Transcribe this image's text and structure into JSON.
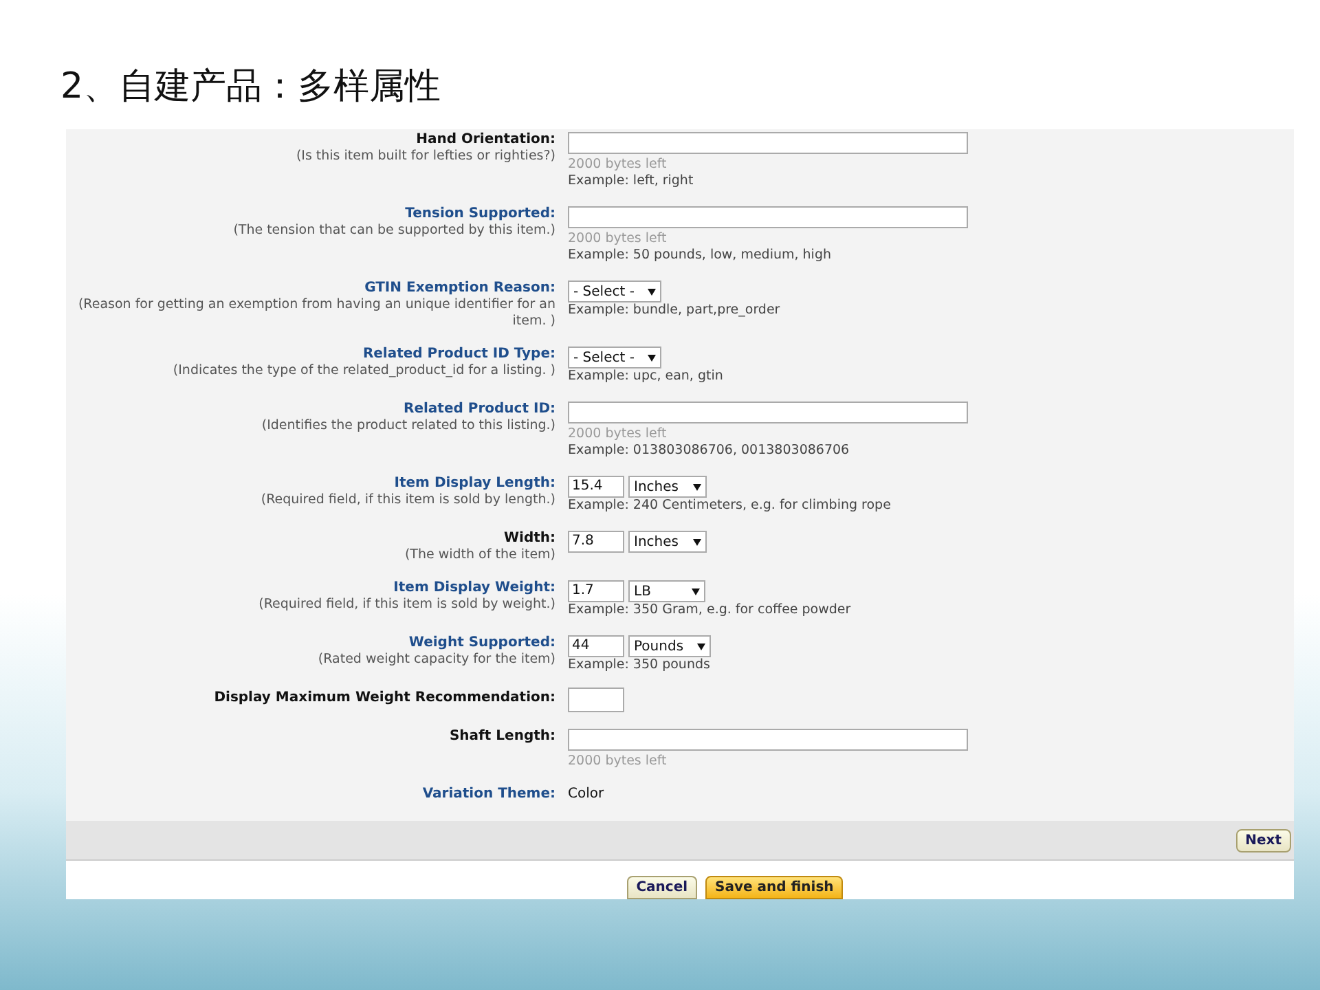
{
  "slide_title": "2、自建产品：多样属性",
  "rows": [
    {
      "label": "Hand Orientation:",
      "linked": false,
      "hint": "(Is this item built for lefties or righties?)",
      "kind": "text",
      "bytes_left": "2000 bytes left",
      "example": "Example: left, right"
    },
    {
      "label": "Tension Supported:",
      "linked": true,
      "hint": "(The tension that can be supported by this item.)",
      "kind": "text",
      "bytes_left": "2000 bytes left",
      "example": "Example: 50 pounds, low, medium, high"
    },
    {
      "label": "GTIN Exemption Reason:",
      "linked": true,
      "hint": "(Reason for getting an exemption from having an unique identifier for an item. )",
      "kind": "select",
      "select": "- Select -",
      "example": "Example: bundle, part,pre_order"
    },
    {
      "label": "Related Product ID Type:",
      "linked": true,
      "hint": "(Indicates the type of the related_product_id for a listing. )",
      "kind": "select",
      "select": "- Select -",
      "example": "Example: upc, ean, gtin"
    },
    {
      "label": "Related Product ID:",
      "linked": true,
      "hint": "(Identifies the product related to this listing.)",
      "kind": "text",
      "bytes_left": "2000 bytes left",
      "example": "Example: 013803086706, 0013803086706"
    },
    {
      "label": "Item Display Length:",
      "linked": true,
      "hint": "(Required field, if this item is sold by length.)",
      "kind": "measure",
      "value": "15.4",
      "select": "Inches",
      "example": "Example: 240 Centimeters, e.g. for climbing rope"
    },
    {
      "label": "Width:",
      "linked": false,
      "hint": "(The width of the item)",
      "kind": "measure",
      "value": "7.8",
      "select": "Inches"
    },
    {
      "label": "Item Display Weight:",
      "linked": true,
      "hint": "(Required field, if this item is sold by weight.)",
      "kind": "measure",
      "value": "1.7",
      "select": "LB",
      "example": "Example: 350 Gram, e.g. for coffee powder"
    },
    {
      "label": "Weight Supported:",
      "linked": true,
      "hint": "(Rated weight capacity for the item)",
      "kind": "measure",
      "value": "44",
      "select": "Pounds",
      "example": "Example: 350 pounds"
    },
    {
      "label": "Display Maximum Weight Recommendation:",
      "linked": false,
      "kind": "small"
    },
    {
      "label": "Shaft Length:",
      "linked": false,
      "kind": "text",
      "bytes_left": "2000 bytes left"
    },
    {
      "label": "Variation Theme:",
      "linked": true,
      "kind": "static",
      "value": "Color"
    }
  ],
  "next_button": "Next",
  "footer_buttons": [
    {
      "label": "Cancel",
      "primary": false
    },
    {
      "label": "Save and finish",
      "primary": true
    }
  ]
}
